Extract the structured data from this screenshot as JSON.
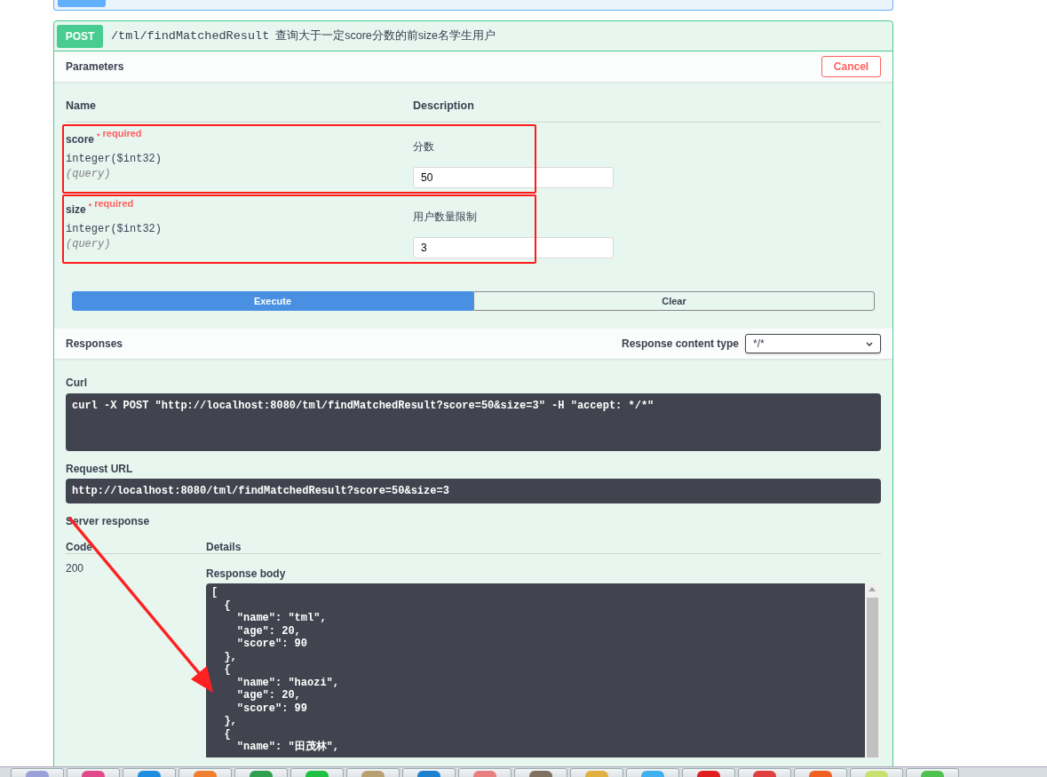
{
  "operation": {
    "method": "POST",
    "path": "/tml/findMatchedResult",
    "summary": "查询大于一定score分数的前size名学生用户"
  },
  "parameters_section": {
    "title": "Parameters",
    "cancel_button": "Cancel",
    "columns": [
      "Name",
      "Description"
    ],
    "parameters": [
      {
        "name": "score",
        "required_mark": "*",
        "required_label": "required",
        "type": "integer($int32)",
        "location": "(query)",
        "description": "分数",
        "value": "50",
        "highlighted": true
      },
      {
        "name": "size",
        "required_mark": "*",
        "required_label": "required",
        "type": "integer($int32)",
        "location": "(query)",
        "description": "用户数量限制",
        "value": "3",
        "highlighted": true
      }
    ]
  },
  "actions": [
    {
      "label": "Execute",
      "kind": "primary"
    },
    {
      "label": "Clear",
      "kind": "secondary"
    }
  ],
  "responses_section": {
    "title": "Responses",
    "content_type_label": "Response content type",
    "content_type": "*/*"
  },
  "curl": {
    "label": "Curl",
    "command": "curl -X POST \"http://localhost:8080/tml/findMatchedResult?score=50&size=3\" -H \"accept: */*\""
  },
  "request_url": {
    "label": "Request URL",
    "url": "http://localhost:8080/tml/findMatchedResult?score=50&size=3"
  },
  "server_response": {
    "title": "Server response",
    "columns": [
      "Code",
      "Details"
    ],
    "code": "200",
    "body_label": "Response body",
    "body_lines": [
      "[",
      "  {",
      "    \"name\": \"tml\",",
      "    \"age\": 20,",
      "    \"score\": 90",
      "  },",
      "  {",
      "    \"name\": \"haozi\",",
      "    \"age\": 20,",
      "    \"score\": 99",
      "  },",
      "  {",
      "    \"name\": \"田茂林\","
    ]
  }
}
